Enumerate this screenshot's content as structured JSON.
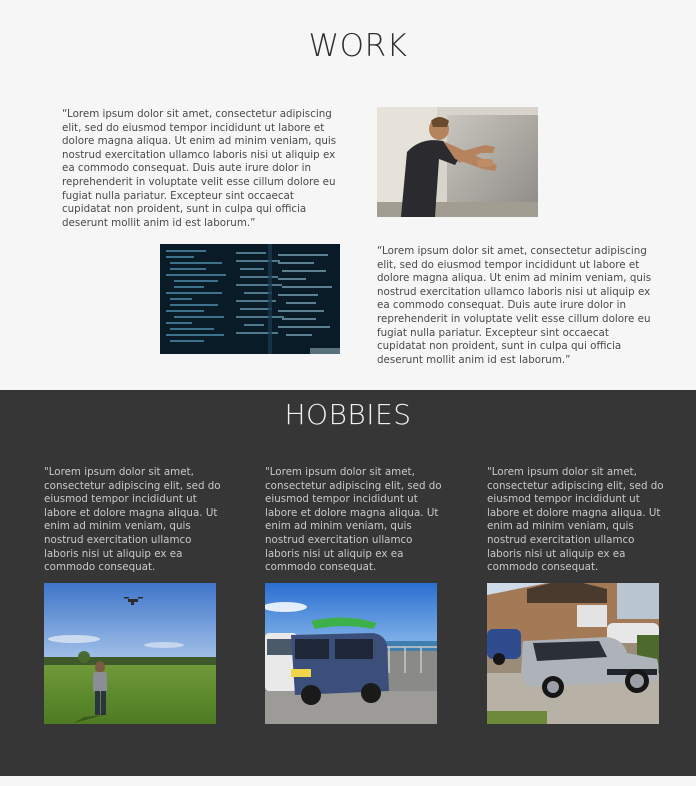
{
  "work": {
    "title": "WORK",
    "blocks": [
      {
        "text": "“Lorem ipsum dolor sit amet, consectetur adipiscing elit, sed do eiusmod tempor incididunt ut labore et dolore magna aliqua. Ut enim ad minim veniam, quis nostrud exercitation ullamco laboris nisi ut aliquip ex ea commodo consequat. Duis aute irure dolor in reprehenderit in voluptate velit esse cillum dolore eu fugiat nulla pariatur. Excepteur sint occaecat cupidatat non proident, sunt in culpa qui officia deserunt mollit anim id est laborum.”",
        "image": "photo-man-working-on-wall"
      },
      {
        "text": "“Lorem ipsum dolor sit amet, consectetur adipiscing elit, sed do eiusmod tempor incididunt ut labore et dolore magna aliqua. Ut enim ad minim veniam, quis nostrud exercitation ullamco laboris nisi ut aliquip ex ea commodo consequat. Duis aute irure dolor in reprehenderit in voluptate velit esse cillum dolore eu fugiat nulla pariatur. Excepteur sint occaecat cupidatat non proident, sunt in culpa qui officia deserunt mollit anim id est laborum.”",
        "image": "photo-code-screen"
      }
    ]
  },
  "hobbies": {
    "title": "HOBBIES",
    "items": [
      {
        "text": "\"Lorem ipsum dolor sit amet, consectetur adipiscing elit, sed do eiusmod tempor incididunt ut labore et dolore magna aliqua. Ut enim ad minim veniam, quis nostrud exercitation ullamco laboris nisi ut aliquip ex ea commodo consequat.",
        "image": "photo-drone-flying-field"
      },
      {
        "text": "\"Lorem ipsum dolor sit amet, consectetur adipiscing elit, sed do eiusmod tempor incididunt ut labore et dolore magna aliqua. Ut enim ad minim veniam, quis nostrud exercitation ullamco laboris nisi ut aliquip ex ea commodo consequat.",
        "image": "photo-blue-van-kayak"
      },
      {
        "text": "\"Lorem ipsum dolor sit amet, consectetur adipiscing elit, sed do eiusmod tempor incididunt ut labore et dolore magna aliqua. Ut enim ad minim veniam, quis nostrud exercitation ullamco laboris nisi ut aliquip ex ea commodo consequat.",
        "image": "photo-silver-car-driveway"
      }
    ]
  },
  "next_section": {
    "title": ""
  },
  "colors": {
    "work_background": "#f6f6f6",
    "hobbies_background": "#363636",
    "heading_dark": "#2e2e2e",
    "heading_light": "#f1f1f1"
  }
}
